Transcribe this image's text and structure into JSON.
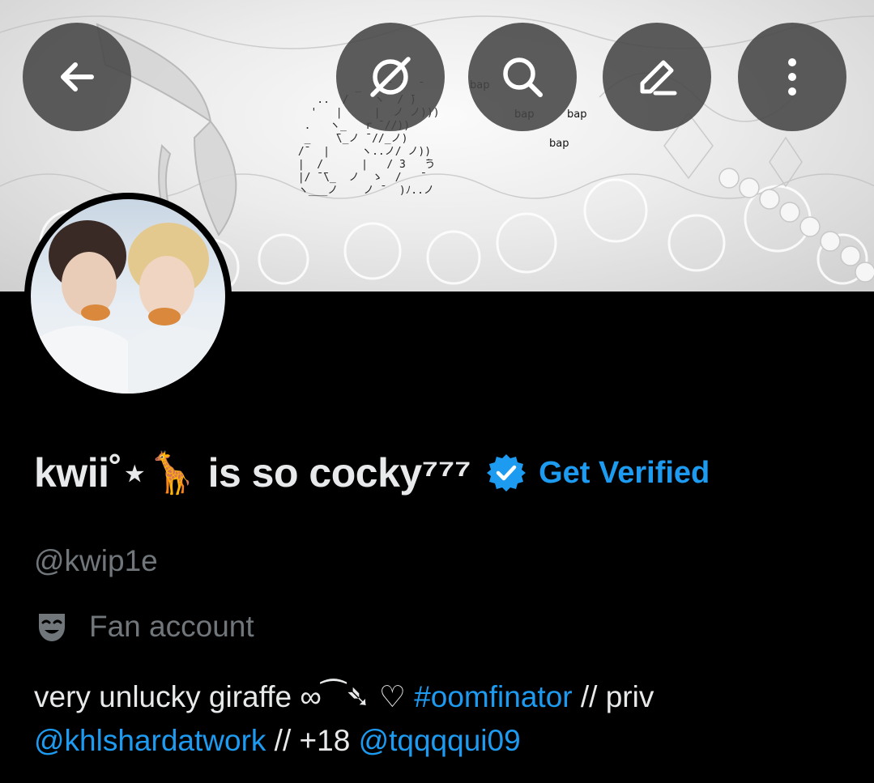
{
  "header": {
    "buttons": [
      {
        "name": "back-arrow-icon"
      },
      {
        "name": "grok-icon"
      },
      {
        "name": "search-icon"
      },
      {
        "name": "edit-pencil-icon"
      },
      {
        "name": "more-vertical-icon"
      }
    ]
  },
  "banner": {
    "bap_labels": [
      "bap",
      "bap",
      "bap",
      "bap"
    ]
  },
  "profile": {
    "display_name": "kwii˚⋆🦒 is so cocky⁷⁷⁷",
    "verified_icon": "verified-badge-icon",
    "get_verified_label": "Get Verified",
    "handle": "@kwip1e",
    "category_icon": "theater-masks-icon",
    "category_label": "Fan account",
    "bio": {
      "text1": "very unlucky giraffe ∞⁀➴ ♡ ",
      "hashtag": "#oomfinator",
      "text2": " // priv",
      "mention1": "@khlshardatwork",
      "text3": " // +18 ",
      "mention2": "@tqqqqui09"
    }
  },
  "colors": {
    "accent": "#1d9bf0",
    "background": "#000000",
    "secondary_text": "#71767b",
    "primary_text": "#e7e9ea",
    "header_button_bg": "#464646"
  }
}
